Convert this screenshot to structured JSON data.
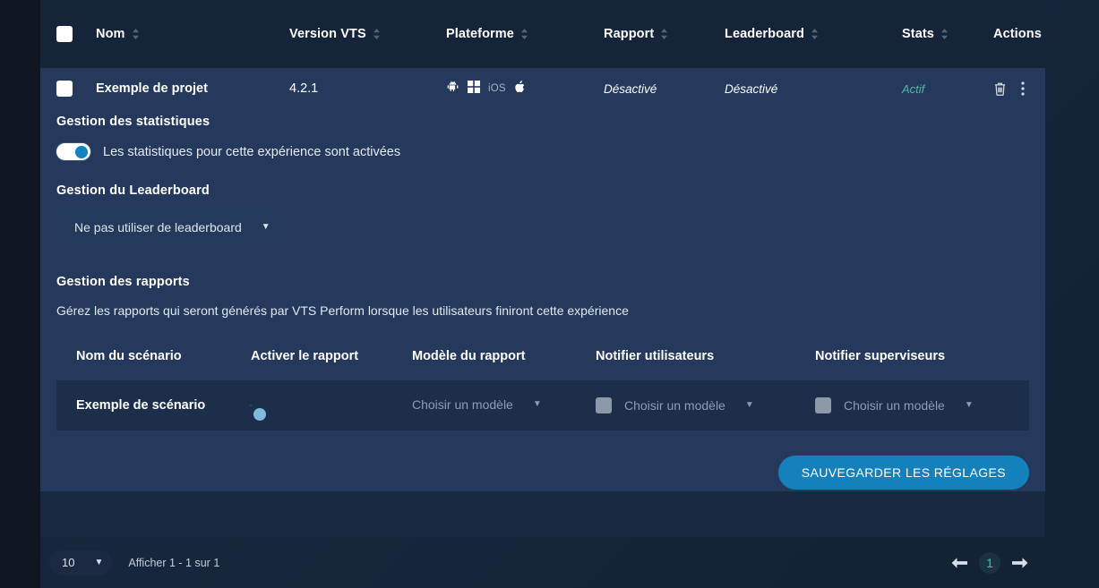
{
  "table": {
    "columns": [
      {
        "key": "nom",
        "label": "Nom",
        "sortable": true
      },
      {
        "key": "version",
        "label": "Version VTS",
        "sortable": true
      },
      {
        "key": "plateforme",
        "label": "Plateforme",
        "sortable": true
      },
      {
        "key": "rapport",
        "label": "Rapport",
        "sortable": true
      },
      {
        "key": "leaderboard",
        "label": "Leaderboard",
        "sortable": true
      },
      {
        "key": "stats",
        "label": "Stats",
        "sortable": true
      },
      {
        "key": "actions",
        "label": "Actions",
        "sortable": false
      }
    ],
    "row": {
      "nom": "Exemple de projet",
      "version": "4.2.1",
      "platforms": [
        "android-icon",
        "windows-icon",
        "ios-label",
        "apple-icon"
      ],
      "ios_label": "iOS",
      "rapport": "Désactivé",
      "leaderboard": "Désactivé",
      "stats": "Actif",
      "delete_icon": "trash-icon",
      "menu_icon": "more-vertical-icon"
    }
  },
  "stats_section": {
    "title": "Gestion des statistiques",
    "toggle_state": "on",
    "toggle_label": "Les statistiques pour cette expérience sont activées"
  },
  "leaderboard_section": {
    "title": "Gestion du Leaderboard",
    "select_value": "Ne pas utiliser de leaderboard",
    "caret": "▼"
  },
  "reports_section": {
    "title": "Gestion des rapports",
    "description": "Gérez les rapports qui seront générés par VTS Perform lorsque les utilisateurs finiront cette expérience",
    "columns": [
      "Nom du scénario",
      "Activer le rapport",
      "Modèle du rapport",
      "Notifier utilisateurs",
      "Notifier superviseurs"
    ],
    "rows": [
      {
        "scenario": "Exemple de scénario",
        "enabled": "off",
        "template": "Choisir un modèle",
        "notify_users_checked": false,
        "notify_users_template": "Choisir un modèle",
        "notify_supervisors_checked": false,
        "notify_supervisors_template": "Choisir un modèle"
      }
    ],
    "save_label": "SAUVEGARDER LES RÉGLAGES"
  },
  "footer": {
    "page_size": "10",
    "page_size_caret": "▼",
    "info": "Afficher 1 - 1 sur 1",
    "prev_icon": "arrow-left-icon",
    "current_page": "1",
    "next_icon": "arrow-right-icon"
  },
  "colors": {
    "accent_blue": "#1481bd",
    "accent_teal": "#35c4b0",
    "panel": "#1a2942",
    "row_expanded": "#24395c"
  }
}
